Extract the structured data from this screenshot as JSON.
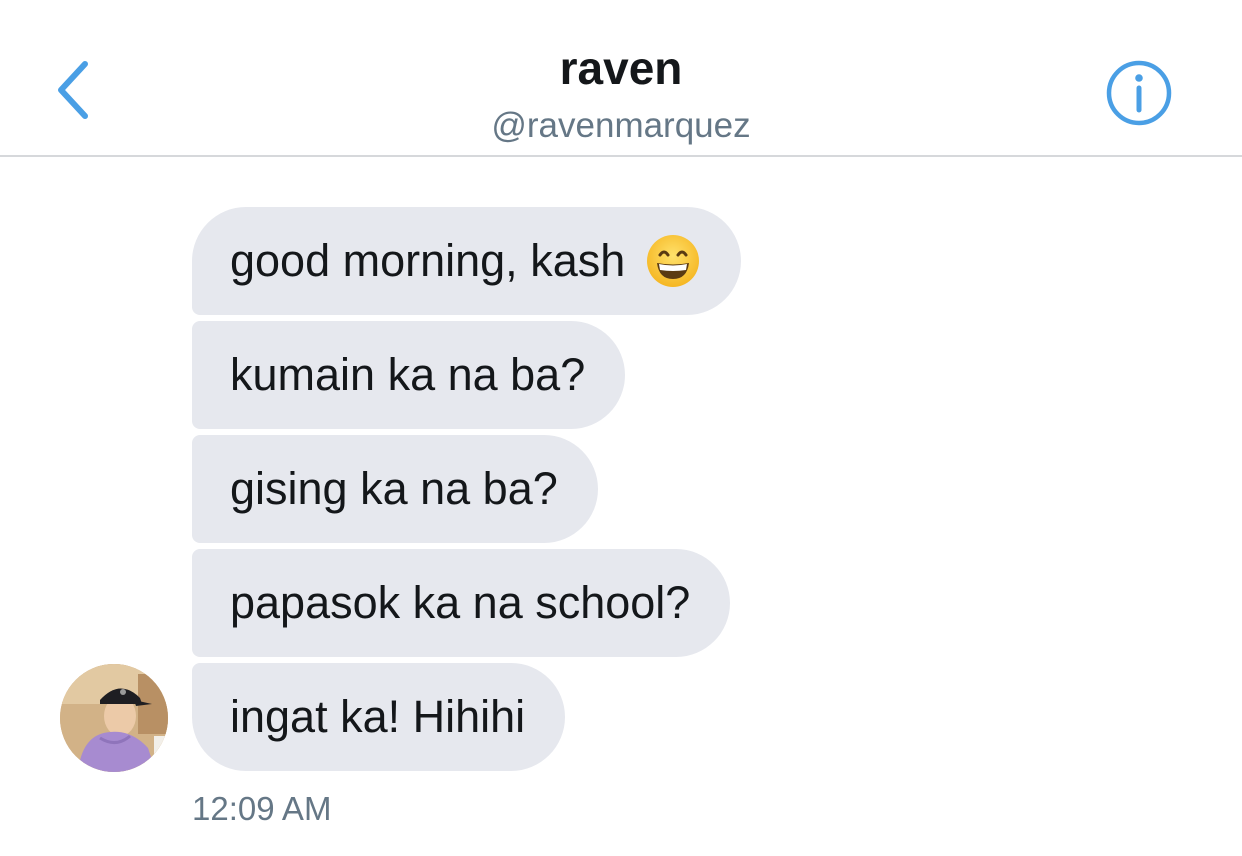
{
  "header": {
    "name": "raven",
    "handle": "@ravenmarquez",
    "back_icon": "chevron-left-icon",
    "info_icon": "info-icon"
  },
  "messages": [
    {
      "text": "good morning, kash",
      "emoji": "grinning-face-icon"
    },
    {
      "text": "kumain ka na ba?"
    },
    {
      "text": "gising ka na ba?"
    },
    {
      "text": "papasok ka na school?"
    },
    {
      "text": "ingat ka! Hihihi"
    }
  ],
  "timestamp": "12:09 AM",
  "colors": {
    "accent": "#4a9fe5",
    "bubble": "#e6e8ee",
    "text": "#14171a",
    "secondary_text": "#657786"
  }
}
